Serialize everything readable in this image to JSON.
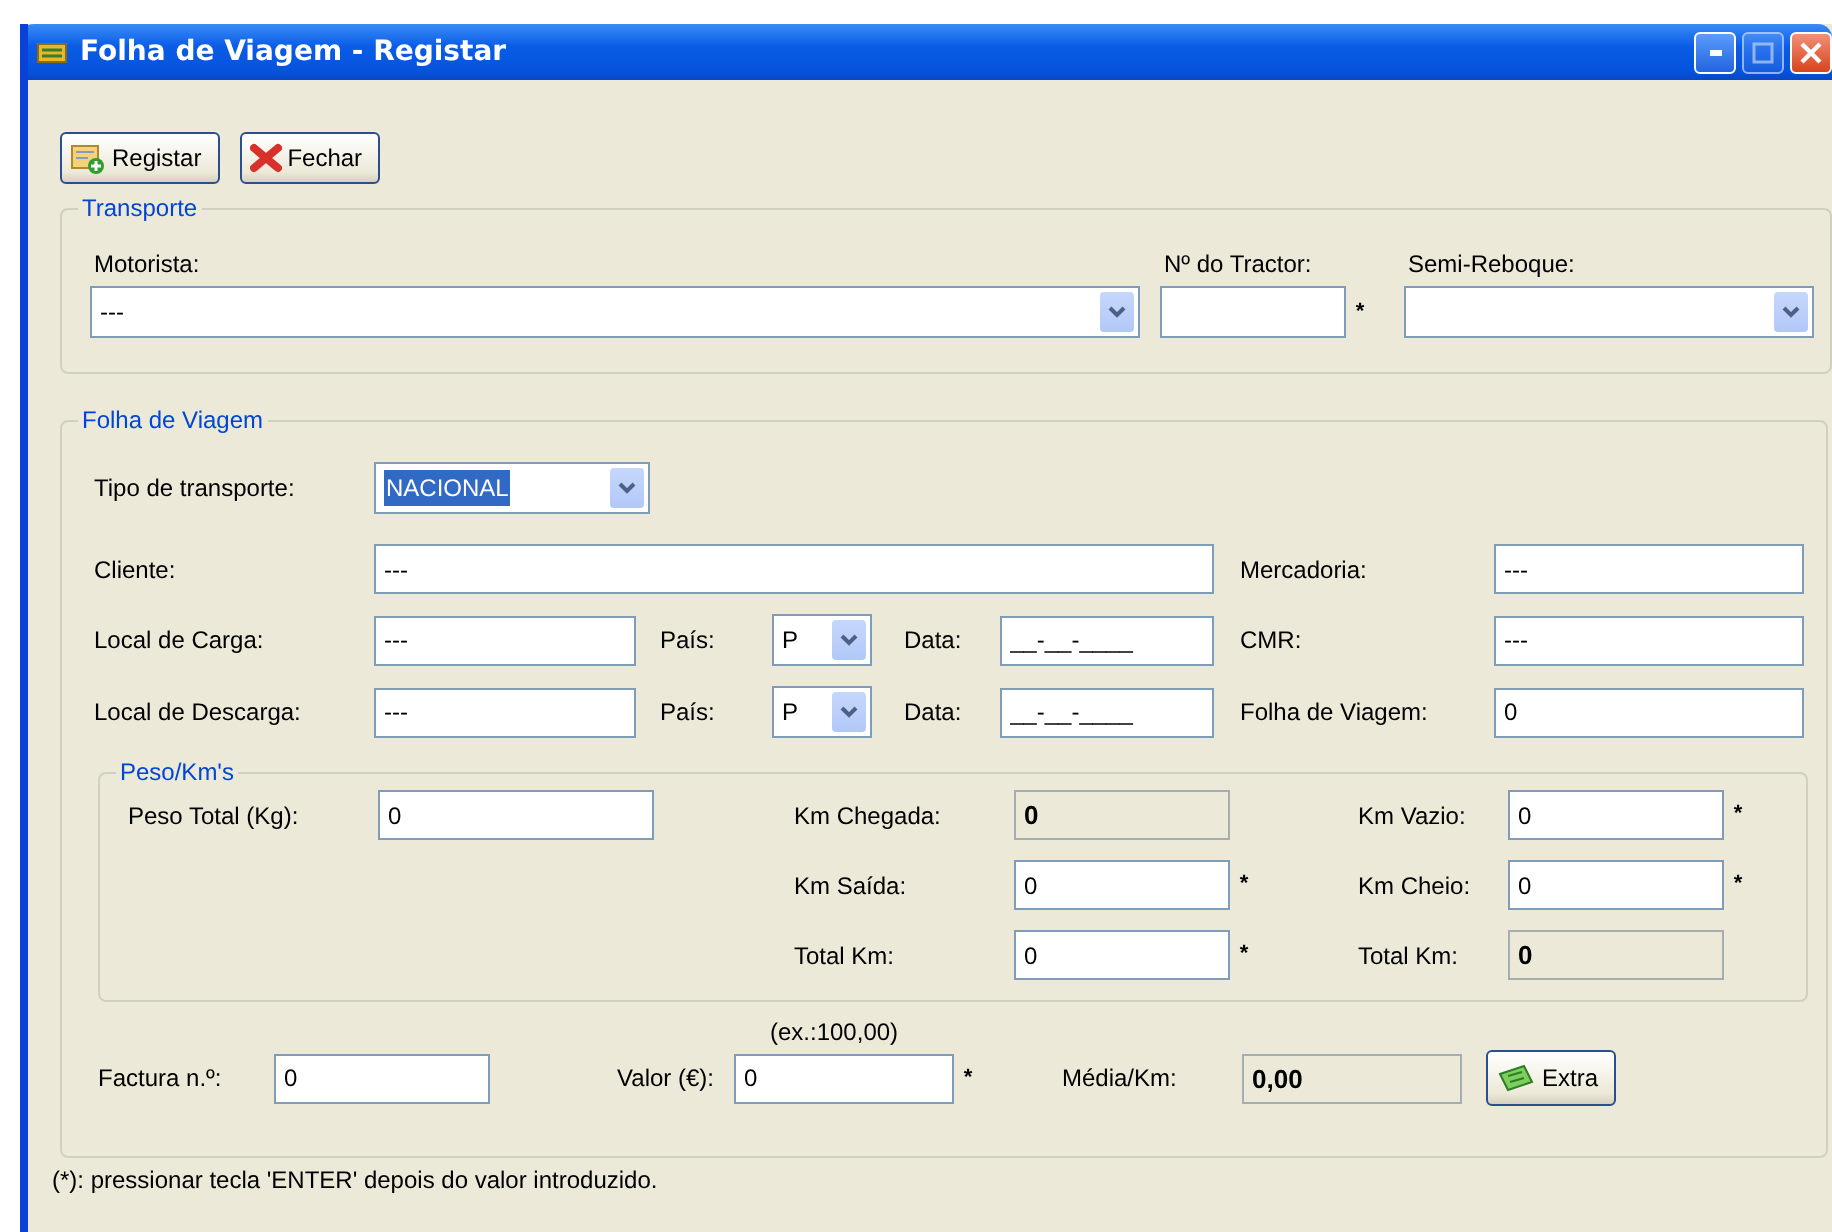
{
  "window": {
    "title": "Folha de Viagem - Registar"
  },
  "toolbar": [
    {
      "label": "Registar",
      "kind": "register"
    },
    {
      "label": "Fechar",
      "kind": "close"
    }
  ],
  "transporte": {
    "title": "Transporte",
    "motorista": {
      "label": "Motorista:",
      "value": "---"
    },
    "tractor": {
      "label": "Nº do Tractor:",
      "marker": "*"
    },
    "semi_reboque": {
      "label": "Semi-Reboque:"
    }
  },
  "folha": {
    "title": "Folha de Viagem",
    "tipo": {
      "label": "Tipo de transporte:",
      "value": "NACIONAL",
      "highlighted": true
    },
    "cliente": {
      "label": "Cliente:",
      "value": "---"
    },
    "mercadoria": {
      "label": "Mercadoria:",
      "value": "---"
    },
    "carga": {
      "label": "Local de Carga:",
      "value": "---",
      "pais_label": "País:",
      "pais": "P",
      "data_label": "Data:",
      "data": "__-__-____"
    },
    "cmr": {
      "label": "CMR:",
      "value": "---"
    },
    "descarga": {
      "label": "Local de Descarga:",
      "value": "---",
      "pais_label": "País:",
      "pais": "P",
      "data_label": "Data:",
      "data": "__-__-____"
    },
    "folha_num": {
      "label": "Folha de Viagem:",
      "value": "0"
    },
    "peso": {
      "title": "Peso/Km's",
      "peso_total": {
        "label": "Peso Total (Kg):",
        "value": "0"
      },
      "km_chegada": {
        "label": "Km Chegada:",
        "value": "0",
        "readonly": true
      },
      "km_vazio": {
        "label": "Km Vazio:",
        "value": "0",
        "marker": "*"
      },
      "km_saida": {
        "label": "Km Saída:",
        "value": "0",
        "marker": "*"
      },
      "km_cheio": {
        "label": "Km Cheio:",
        "value": "0",
        "marker": "*"
      },
      "total_km": {
        "label": "Total Km:",
        "value": "0",
        "marker": "*"
      },
      "total_km_2": {
        "label": "Total Km:",
        "value": "0",
        "readonly": true
      }
    },
    "hint": "(ex.:100,00)",
    "factura": {
      "label": "Factura n.º:",
      "value": "0"
    },
    "valor": {
      "label": "Valor (€):",
      "value": "0",
      "marker": "*"
    },
    "media": {
      "label": "Média/Km:",
      "value": "0,00",
      "readonly": true
    },
    "extra": {
      "label": "Extra"
    }
  },
  "footnote": "(*): pressionar tecla 'ENTER' depois do valor introduzido."
}
